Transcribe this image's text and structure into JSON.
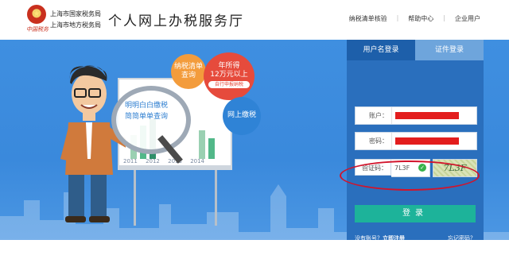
{
  "header": {
    "seal_text": "中国税务",
    "bureau_line1": "上海市国家税务局",
    "bureau_line2": "上海市地方税务局",
    "site_title": "个人网上办税服务厅",
    "nav": [
      "纳税清单核验",
      "帮助中心",
      "企业用户"
    ]
  },
  "banner": {
    "magnifier_text_line1": "明明白白缴税",
    "magnifier_text_line2": "简简单单查询",
    "bubble_orange": "纳税清单查询",
    "bubble_red_line1": "年所得",
    "bubble_red_line2": "12万元以上",
    "bubble_red_sub": "自行申报纳税",
    "bubble_blue": "网上缴税",
    "chart_years": [
      "2011",
      "2012",
      "2013",
      "2014"
    ]
  },
  "login": {
    "tab_active": "用户名登录",
    "tab_inactive": "证件登录",
    "account_label": "账户：",
    "password_label": "密码：",
    "captcha_label": "验证码：",
    "captcha_value": "7L3F",
    "captcha_image_text": "7L3F",
    "login_button": "登录",
    "no_account_text": "没有账号？",
    "register_link": "立即注册",
    "forgot_link": "忘记密码？",
    "colors": {
      "panel": "#1d5faa",
      "button": "#1db39a",
      "highlight_ring": "#d2142b",
      "redacted": "#e31d1d"
    }
  }
}
